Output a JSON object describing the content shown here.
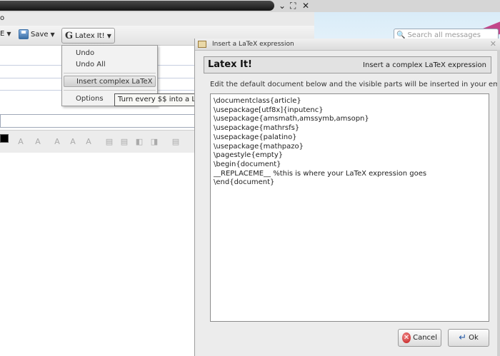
{
  "main_window": {
    "menu_partial": "o",
    "toolbar": {
      "partial_label": "E",
      "save_label": "Save",
      "latex_label": "Latex It!"
    },
    "search": {
      "placeholder": "Search all messages"
    }
  },
  "latex_menu": {
    "items": [
      {
        "label": "Undo"
      },
      {
        "label": "Undo All"
      },
      {
        "label": "Insert complex LaTeX",
        "active": true
      },
      {
        "label": "Options"
      }
    ],
    "tooltip": "Turn every $$ into a LaTeX image"
  },
  "dialog": {
    "window_title": "Insert a LaTeX expression",
    "heading": "Latex It!",
    "subheading": "Insert a complex LaTeX expression",
    "description": "Edit the default document below and the visible parts will be inserted in your email",
    "editor_lines": [
      "\\documentclass{article}",
      "\\usepackage[utf8x]{inputenc}",
      "\\usepackage{amsmath,amssymb,amsopn}",
      "\\usepackage{mathrsfs}",
      "\\usepackage{palatino}",
      "\\usepackage{mathpazo}",
      "\\pagestyle{empty}",
      "\\begin{document}",
      "__REPLACEME__ %this is where your LaTeX expression goes",
      "\\end{document}"
    ],
    "cancel_label": "Cancel",
    "ok_label": "Ok"
  }
}
